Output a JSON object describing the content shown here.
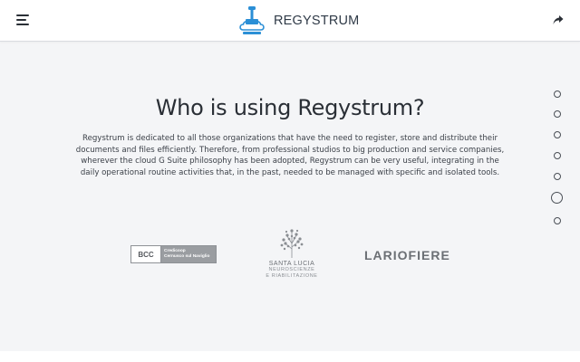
{
  "header": {
    "brand_name": "REGYSTRUM"
  },
  "main": {
    "title": "Who is using Regystrum?",
    "description": "Regystrum is dedicated to all those organizations that have the need to register, store and distribute their documents and files efficiently. Therefore, from professional studios to big production and service companies, wherever the cloud G Suite philosophy has been adopted, Regystrum can be very useful, integrating in the daily operational routine activities that, in the past, needed to be managed with specific and isolated tools."
  },
  "logos": {
    "bcc": {
      "mark": "BCC",
      "line1": "Credicoop",
      "line2": "Cernusco sul Naviglio"
    },
    "santa_lucia": {
      "name": "SANTA LUCIA",
      "sub1": "NEUROSCIENZE",
      "sub2": "E RIABILITAZIONE"
    },
    "lariofiere": {
      "name": "LARIOFIERE"
    }
  },
  "nav_dots": {
    "count": 7,
    "active_index": 5
  },
  "icons": {
    "menu": "hamburger-menu-icon",
    "share": "share-arrow-icon",
    "logo": "regystrum-stamp-cloud-logo"
  },
  "colors": {
    "brand_blue": "#2b8fd6",
    "text": "#2a2f36",
    "background": "#f4f5f7"
  }
}
